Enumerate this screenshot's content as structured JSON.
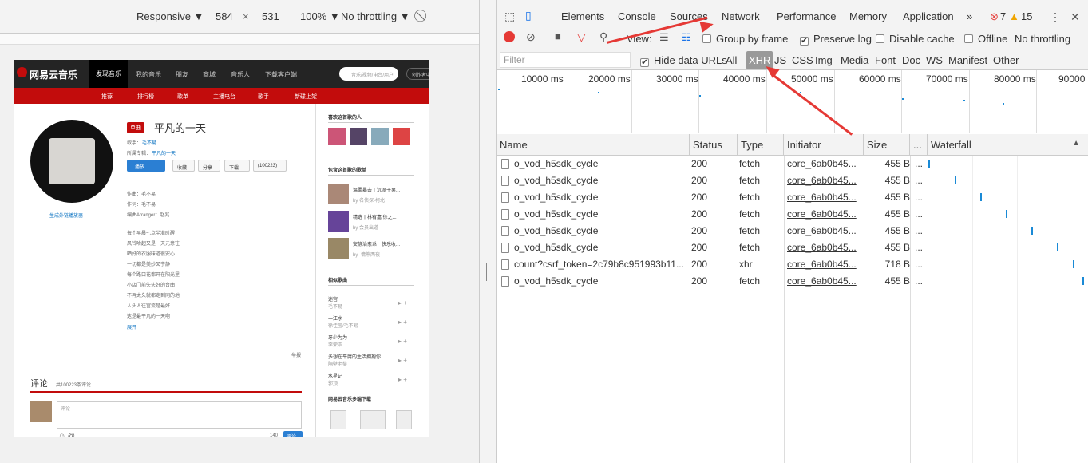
{
  "device_toolbar": {
    "mode": "Responsive ▼",
    "width": "584",
    "times": "×",
    "height": "531",
    "zoom": "100% ▼",
    "throttle": "No throttling ▼"
  },
  "emulated_page": {
    "logo": "网易云音乐",
    "nav": [
      "发现音乐",
      "我的音乐",
      "朋友",
      "商城",
      "音乐人",
      "下载客户端"
    ],
    "search_placeholder": "音乐/视频/电台/用户",
    "creator_label": "创作者中心",
    "subnav": [
      "推荐",
      "排行榜",
      "歌单",
      "主播电台",
      "歌手",
      "新碟上架"
    ],
    "song_tag": "单曲",
    "song_title": "平凡的一天",
    "singer_label": "歌手：",
    "singer": "毛不易",
    "album_label": "所属专辑：",
    "album": "平凡的一天",
    "buttons": [
      "播放",
      "收藏",
      "分享",
      "下载",
      "(100223)"
    ],
    "credits": [
      "作曲：毛不易",
      "作词：毛不易",
      "编曲Arranger：赵兆"
    ],
    "lyrics": [
      "每个早晨七点半准时醒",
      "风铃哈起又是一天元意往",
      "晒好的衣服味道很安心",
      "一切都是美妙又宁静",
      "每个路口花都开在阳光里",
      "小店门前失头好的台曲",
      "不再太久就都走到同的地",
      "人头人往宫流是最好",
      "这是最平凡的一天啊"
    ],
    "expand": "展开",
    "report": "举报",
    "generate_link": "生成外链播放器",
    "comment_title": "评论",
    "comment_count": "共100223条评论",
    "comment_placeholder": "评论",
    "comment_submit": "评论",
    "comment_chars": "140",
    "side_liked_title": "喜欢这首歌的人",
    "side_playlists_title": "包含这首歌的歌单",
    "side_playlists": [
      {
        "name": "温柔暴击丨沉溺于男...",
        "by": "by 名侦探-柯北"
      },
      {
        "name": "精选丨林宥嘉 徐之...",
        "by": "by 会员出道"
      },
      {
        "name": "安静治愈系：快乐收...",
        "by": "by -慵熊两夜-"
      }
    ],
    "side_similar_title": "相似歌曲",
    "side_similar": [
      {
        "name": "迷宫",
        "artist": "毛不易"
      },
      {
        "name": "一江水",
        "artist": "徐佳莹/毛不易"
      },
      {
        "name": "牙少为为",
        "artist": "李荣浩"
      },
      {
        "name": "多想在平庸的生活拥抱你",
        "artist": "隔壁老樊"
      },
      {
        "name": "水星记",
        "artist": "郭顶"
      }
    ],
    "side_download_title": "网易云音乐多端下载"
  },
  "devtools": {
    "tabs": [
      "Elements",
      "Console",
      "Sources",
      "Network",
      "Performance",
      "Memory",
      "Application",
      "»"
    ],
    "active_tab": "Network",
    "errors": "7",
    "warnings": "15",
    "toolbar": {
      "view_label": "View:",
      "group_by_frame": "Group by frame",
      "preserve_log": "Preserve log",
      "disable_cache": "Disable cache",
      "offline": "Offline",
      "throttling": "No throttling"
    },
    "filter": {
      "placeholder": "Filter",
      "hide_data_urls": "Hide data URLs",
      "types": [
        "All",
        "XHR",
        "JS",
        "CSS",
        "Img",
        "Media",
        "Font",
        "Doc",
        "WS",
        "Manifest",
        "Other"
      ],
      "active_type": "XHR"
    },
    "overview_labels": [
      "10000 ms",
      "20000 ms",
      "30000 ms",
      "40000 ms",
      "50000 ms",
      "60000 ms",
      "70000 ms",
      "80000 ms",
      "90000 ms"
    ],
    "columns": [
      "Name",
      "Status",
      "Type",
      "Initiator",
      "Size",
      "...",
      "Waterfall"
    ],
    "sort_indicator": "▲",
    "rows": [
      {
        "name": "o_vod_h5sdk_cycle",
        "status": "200",
        "type": "fetch",
        "initiator": "core_6ab0b45...",
        "size": "455 B",
        "more": "..."
      },
      {
        "name": "o_vod_h5sdk_cycle",
        "status": "200",
        "type": "fetch",
        "initiator": "core_6ab0b45...",
        "size": "455 B",
        "more": "..."
      },
      {
        "name": "o_vod_h5sdk_cycle",
        "status": "200",
        "type": "fetch",
        "initiator": "core_6ab0b45...",
        "size": "455 B",
        "more": "..."
      },
      {
        "name": "o_vod_h5sdk_cycle",
        "status": "200",
        "type": "fetch",
        "initiator": "core_6ab0b45...",
        "size": "455 B",
        "more": "..."
      },
      {
        "name": "o_vod_h5sdk_cycle",
        "status": "200",
        "type": "fetch",
        "initiator": "core_6ab0b45...",
        "size": "455 B",
        "more": "..."
      },
      {
        "name": "o_vod_h5sdk_cycle",
        "status": "200",
        "type": "fetch",
        "initiator": "core_6ab0b45...",
        "size": "455 B",
        "more": "..."
      },
      {
        "name": "count?csrf_token=2c79b8c951993b11...",
        "status": "200",
        "type": "xhr",
        "initiator": "core_6ab0b45...",
        "size": "718 B",
        "more": "..."
      },
      {
        "name": "o_vod_h5sdk_cycle",
        "status": "200",
        "type": "fetch",
        "initiator": "core_6ab0b45...",
        "size": "455 B",
        "more": "..."
      }
    ]
  },
  "colors": {
    "accent": "#1a73e8",
    "annotation_arrow": "#e53935",
    "brand_red": "#c20c0c"
  }
}
